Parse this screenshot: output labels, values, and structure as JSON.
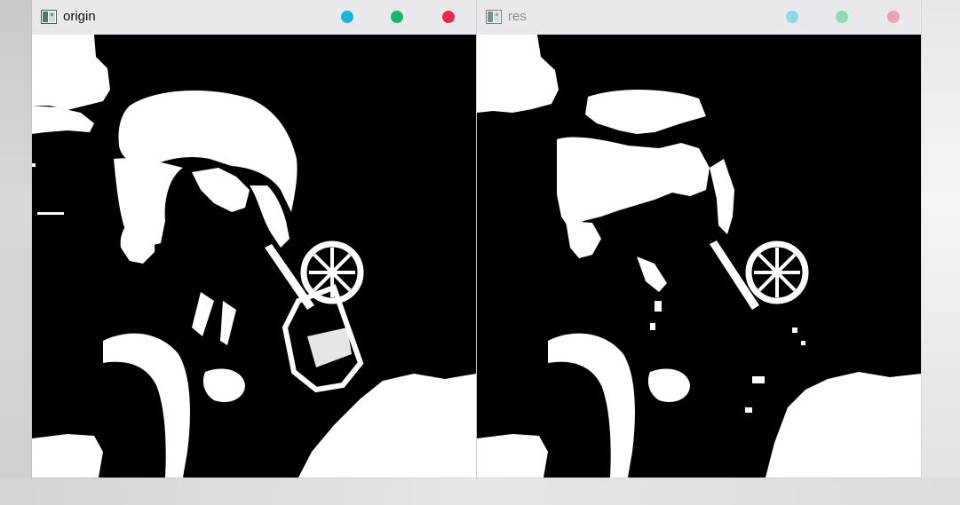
{
  "windows": [
    {
      "title": "origin",
      "controls": [
        {
          "name": "minimize",
          "color": "#17b7d6"
        },
        {
          "name": "maximize",
          "color": "#1db46e"
        },
        {
          "name": "close",
          "color": "#e52952"
        }
      ]
    },
    {
      "title": "res",
      "controls": [
        {
          "name": "minimize",
          "color": "#8fd9e6"
        },
        {
          "name": "maximize",
          "color": "#8fd9b9"
        },
        {
          "name": "close",
          "color": "#eba2b6"
        }
      ]
    }
  ]
}
